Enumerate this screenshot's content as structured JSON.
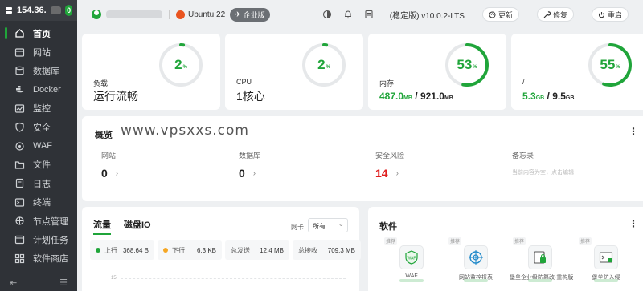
{
  "sidebar": {
    "server_ip": "154.36.",
    "alert_count": "0",
    "nav_items": [
      {
        "label": "首页",
        "icon": "home-icon",
        "active": true
      },
      {
        "label": "网站",
        "icon": "globe-icon"
      },
      {
        "label": "数据库",
        "icon": "database-icon"
      },
      {
        "label": "Docker",
        "icon": "docker-icon"
      },
      {
        "label": "监控",
        "icon": "monitor-icon"
      },
      {
        "label": "安全",
        "icon": "shield-icon"
      },
      {
        "label": "WAF",
        "icon": "waf-icon"
      },
      {
        "label": "文件",
        "icon": "folder-icon"
      },
      {
        "label": "日志",
        "icon": "log-icon"
      },
      {
        "label": "终端",
        "icon": "terminal-icon"
      },
      {
        "label": "节点管理",
        "icon": "node-icon"
      },
      {
        "label": "计划任务",
        "icon": "calendar-icon"
      },
      {
        "label": "软件商店",
        "icon": "store-icon"
      }
    ]
  },
  "topbar": {
    "os_name": "Ubuntu 22",
    "edition_badge": "企业版",
    "version": "(稳定版) v10.0.2-LTS",
    "update_label": "更新",
    "repair_label": "修复",
    "restart_label": "重启"
  },
  "stats": {
    "load": {
      "label": "负载",
      "value": "运行流畅",
      "percent": 2
    },
    "cpu": {
      "label": "CPU",
      "value": "1核心",
      "percent": 2
    },
    "memory": {
      "label": "内存",
      "used": "487.0",
      "used_unit": "MB",
      "total": "921.0",
      "total_unit": "MB",
      "percent": 53
    },
    "disk": {
      "label": "/",
      "used": "5.3",
      "used_unit": "GB",
      "total": "9.5",
      "total_unit": "GB",
      "percent": 55
    },
    "percent_unit": "%"
  },
  "overview": {
    "title": "概览",
    "watermark": "www.vpsxxs.com",
    "items": [
      {
        "label": "网站",
        "value": "0"
      },
      {
        "label": "数据库",
        "value": "0"
      },
      {
        "label": "安全风险",
        "value": "14"
      },
      {
        "label": "备忘录",
        "memo": "当前内容为空，点击编辑"
      }
    ]
  },
  "traffic": {
    "tabs": [
      "流量",
      "磁盘IO"
    ],
    "nic_label": "网卡",
    "nic_value": "所有",
    "upload_label": "上行",
    "upload_value": "368.64 B",
    "download_label": "下行",
    "download_value": "6.3 KB",
    "total_sent_label": "总发送",
    "total_sent_value": "12.4 MB",
    "total_recv_label": "总接收",
    "total_recv_value": "709.3 MB",
    "chart_tick": "15"
  },
  "software": {
    "title": "软件",
    "items": [
      {
        "tag": "推荐",
        "name": "WAF",
        "icon": "waf-shield-icon"
      },
      {
        "tag": "推荐",
        "name": "网站监控报表",
        "icon": "crosshair-icon"
      },
      {
        "tag": "推荐",
        "name": "堡垒企业级防篡改-重构版",
        "icon": "anti-tamper-icon"
      },
      {
        "tag": "推荐",
        "name": "堡垒防入侵",
        "icon": "intrusion-icon"
      }
    ]
  },
  "colors": {
    "accent": "#20a53a",
    "danger": "#e02020",
    "sidebar_bg": "#2f3237"
  }
}
